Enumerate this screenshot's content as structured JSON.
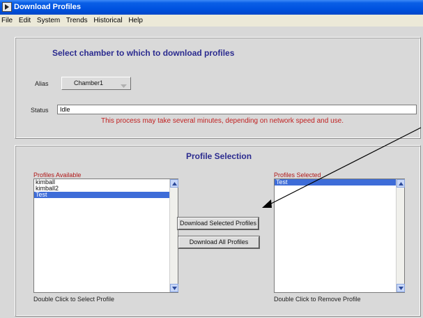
{
  "window": {
    "title": "Download Profiles"
  },
  "menu": [
    "File",
    "Edit",
    "System",
    "Trends",
    "Historical",
    "Help"
  ],
  "chamber_panel": {
    "heading": "Select chamber to which to download profiles",
    "alias_label": "Alias",
    "alias_value": "Chamber1",
    "status_label": "Status",
    "status_value": "Idle",
    "warning": "This process may take several minutes, depending on network speed and use."
  },
  "profile_panel": {
    "heading": "Profile Selection",
    "available_label": "Profiles Available",
    "available_items": [
      "kimball",
      "kimball2",
      "Test"
    ],
    "available_selected": "Test",
    "available_hint": "Double Click to Select Profile",
    "selected_label": "Profiles Selected",
    "selected_items": [
      "Test"
    ],
    "selected_hint": "Double Click to Remove Profile",
    "download_selected_label": "Download Selected Profiles",
    "download_all_label": "Download All Profiles"
  },
  "colors": {
    "title_bar": "#0052e0",
    "heading": "#2b2b8f",
    "warning": "#c02020",
    "list_label": "#b01818",
    "selection": "#3d6cd8"
  },
  "icons": [
    "app-icon",
    "dropdown-arrow-icon",
    "scroll-up-icon",
    "scroll-down-icon"
  ]
}
